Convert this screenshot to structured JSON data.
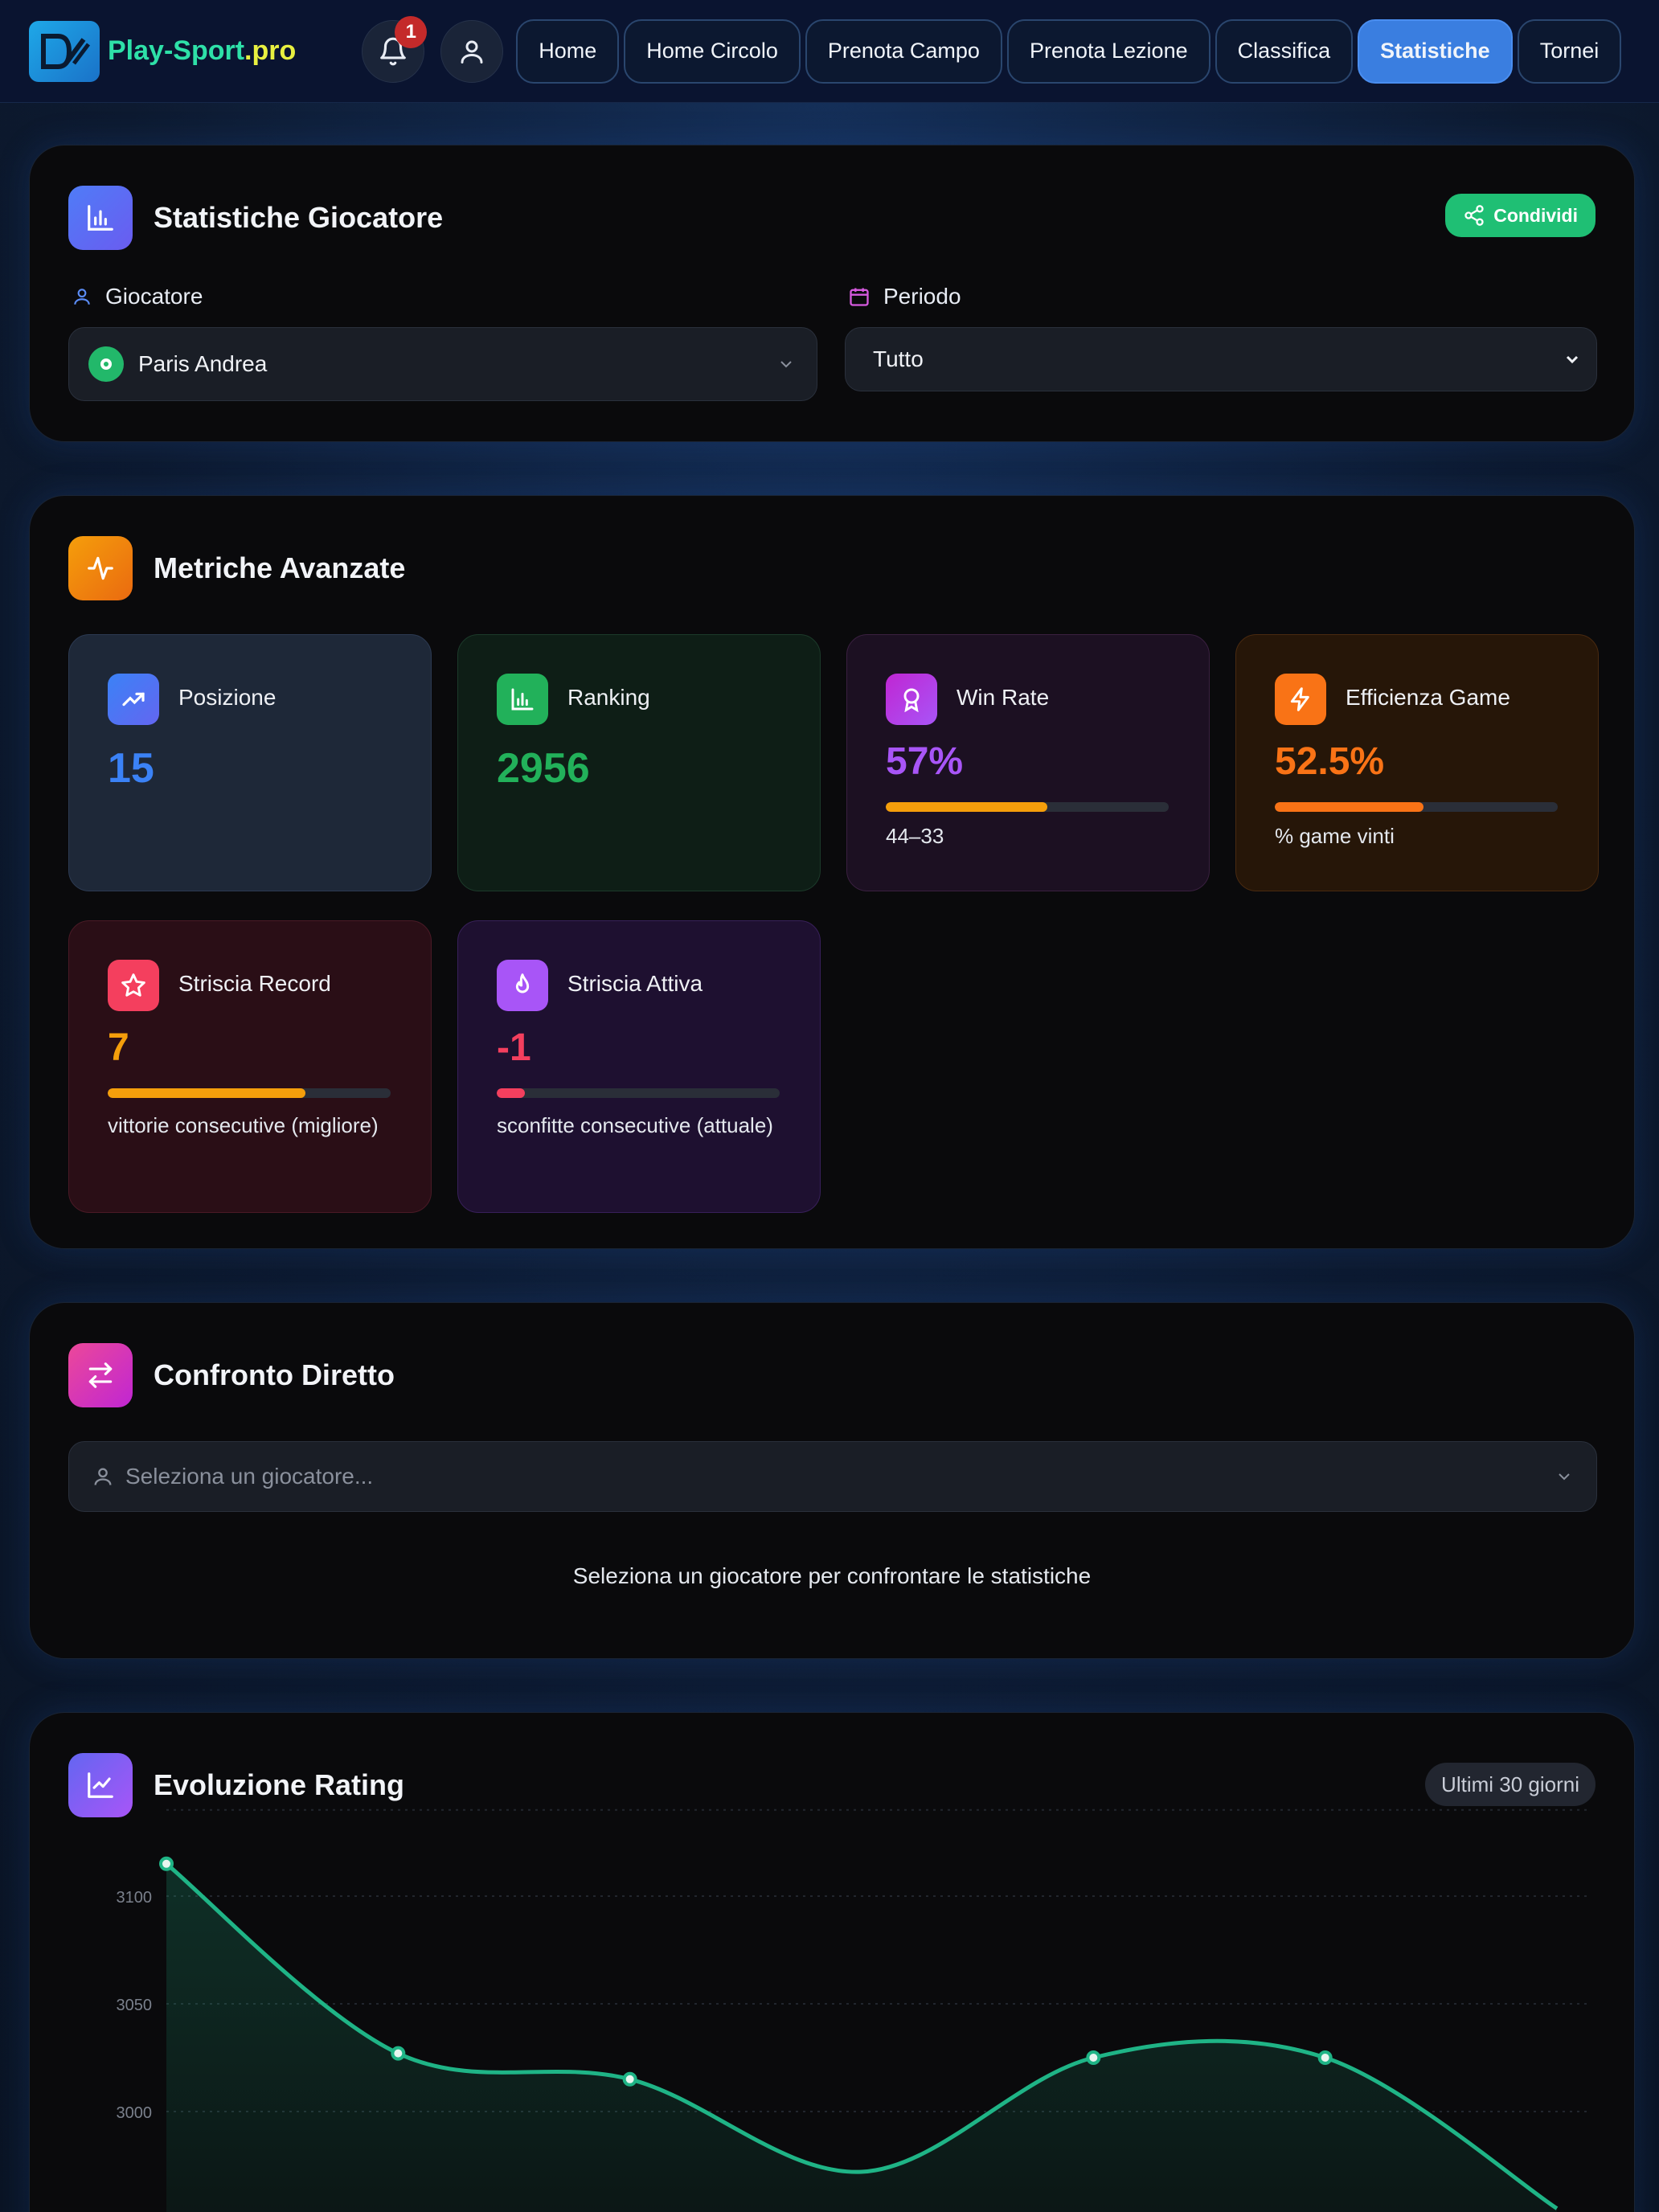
{
  "brand": {
    "name": "Play-Sport",
    "tld": ".pro"
  },
  "notifications": {
    "count": "1"
  },
  "nav": {
    "tabs": [
      {
        "label": "Home"
      },
      {
        "label": "Home Circolo"
      },
      {
        "label": "Prenota Campo"
      },
      {
        "label": "Prenota Lezione"
      },
      {
        "label": "Classifica"
      },
      {
        "label": "Statistiche",
        "active": true
      },
      {
        "label": "Tornei"
      }
    ]
  },
  "stats": {
    "title": "Statistiche Giocatore",
    "share_label": "Condividi",
    "player_label": "Giocatore",
    "player_value": "Paris Andrea",
    "period_label": "Periodo",
    "period_value": "Tutto"
  },
  "metrics": {
    "title": "Metriche Avanzate",
    "items": [
      {
        "label": "Posizione",
        "value": "15",
        "color": "#3b82f6"
      },
      {
        "label": "Ranking",
        "value": "2956",
        "color": "#22c55e"
      },
      {
        "label": "Win Rate",
        "value": "57%",
        "sub": "44–33",
        "progress": 0.57,
        "color": "#a855f7"
      },
      {
        "label": "Efficienza Game",
        "value": "52.5%",
        "sub": "% game vinti",
        "progress": 0.525,
        "color": "#f97316"
      },
      {
        "label": "Striscia Record",
        "value": "7",
        "sub": "vittorie consecutive (migliore)",
        "progress": 0.7,
        "color": "#f59e0b"
      },
      {
        "label": "Striscia Attiva",
        "value": "-1",
        "sub": "sconfitte consecutive (attuale)",
        "progress": 0.1,
        "color": "#f43f5e"
      }
    ]
  },
  "compare": {
    "title": "Confronto Diretto",
    "placeholder": "Seleziona un giocatore...",
    "empty": "Seleziona un giocatore per confrontare le statistiche"
  },
  "rating": {
    "title": "Evoluzione Rating",
    "range": "Ultimi 30 giorni"
  },
  "chart_data": {
    "type": "area",
    "color": "#1fb486",
    "yticks": [
      "3100",
      "3050",
      "3000"
    ],
    "ylim": [
      2950,
      3140
    ],
    "points": [
      3115,
      3027,
      3015,
      2972,
      3025,
      3025,
      2955
    ]
  }
}
